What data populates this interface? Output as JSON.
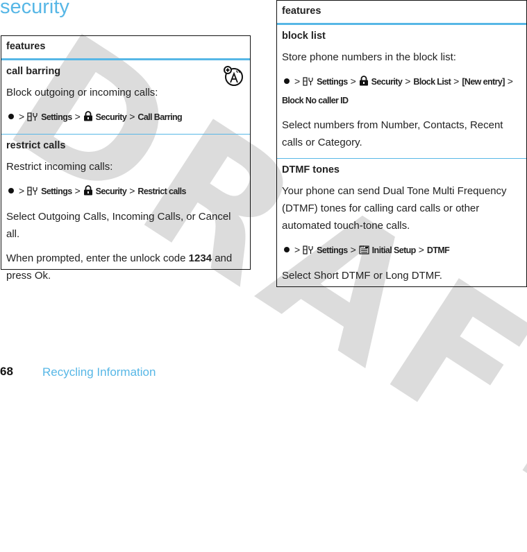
{
  "page": {
    "title": "security",
    "watermark": "DRAFT",
    "accent_color": "#57b7e6",
    "footer": {
      "page_number": "68",
      "section": "Recycling Information"
    }
  },
  "left_table": {
    "header": "features",
    "sections": [
      {
        "title": "call barring",
        "network_icon": "network-dependent-icon",
        "description": "Block outgoing or incoming calls:",
        "path": [
          "Settings",
          "Security",
          "Call Barring"
        ]
      },
      {
        "title": "restrict calls",
        "description": "Restrict incoming calls:",
        "path": [
          "Settings",
          "Security",
          "Restrict calls"
        ],
        "select_prefix": "Select ",
        "select_options": [
          "Outgoing Calls, Incoming Calls",
          "Cancel all."
        ],
        "select_joiner": ", or ",
        "unlock_prefix": "When prompted, enter the unlock code ",
        "unlock_code": "1234",
        "unlock_middle": " and press ",
        "unlock_key": "Ok",
        "unlock_suffix": "."
      }
    ]
  },
  "right_table": {
    "header": "features",
    "sections": [
      {
        "title": "block list",
        "description": "Store phone numbers in the block list:",
        "path": [
          "Settings",
          "Security",
          "Block List",
          "[New entry]",
          "Block No caller ID"
        ],
        "select_prefix": "Select numbers from ",
        "select_options": [
          "Number, Contacts, Recent calls",
          "Category."
        ],
        "select_joiner": " or "
      },
      {
        "title": "DTMF tones",
        "description": "Your phone can send Dual Tone Multi Frequency (DTMF) tones for calling card calls or other automated touch-tone calls.",
        "path": [
          "Settings",
          "Initial Setup",
          "DTMF"
        ],
        "select_prefix": "Select ",
        "select_options": [
          "Short DTMF",
          "Long DTMF"
        ],
        "select_joiner": " or ",
        "select_suffix": "."
      }
    ]
  },
  "icons": {
    "nav_key": "nav-key-icon",
    "settings": "settings-icon",
    "security": "lock-icon",
    "initial_setup": "initial-setup-icon"
  },
  "separator": ">"
}
